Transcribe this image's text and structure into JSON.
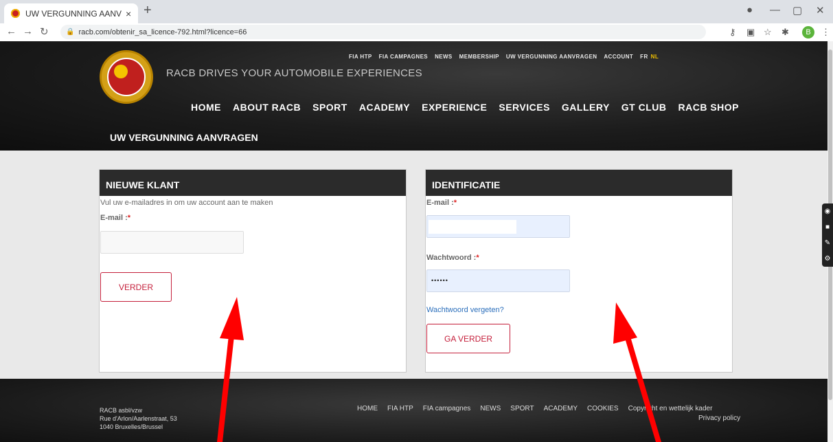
{
  "browser": {
    "tab_title": "UW VERGUNNING AANVRAGEN",
    "tab_close": "×",
    "new_tab": "+",
    "url": "racb.com/obtenir_sa_licence-792.html?licence=66",
    "profile_initial": "B"
  },
  "header": {
    "tagline": "RACB DRIVES YOUR AUTOMOBILE EXPERIENCES",
    "top_menu": [
      "FIA HTP",
      "FIA CAMPAGNES",
      "NEWS",
      "MEMBERSHIP",
      "UW VERGUNNING AANVRAGEN",
      "ACCOUNT"
    ],
    "lang_fr": "FR",
    "lang_nl": "NL",
    "main_menu": [
      "HOME",
      "ABOUT RACB",
      "SPORT",
      "ACADEMY",
      "EXPERIENCE",
      "SERVICES",
      "GALLERY",
      "GT CLUB",
      "RACB SHOP"
    ],
    "page_title": "UW VERGUNNING AANVRAGEN"
  },
  "new_client": {
    "heading": "NIEUWE KLANT",
    "intro": "Vul uw e-mailadres in om uw account aan te maken",
    "email_label": "E-mail :",
    "required": "*",
    "button": "VERDER"
  },
  "identification": {
    "heading": "IDENTIFICATIE",
    "email_label": "E-mail :",
    "password_label": "Wachtwoord :",
    "required": "*",
    "password_value": "••••••",
    "forgot": "Wachtwoord vergeten?",
    "button": "GA VERDER"
  },
  "footer": {
    "address": [
      "RACB asbl/vzw",
      "Rue d'Arlon/Aarlenstraat, 53",
      "1040 Bruxelles/Brussel"
    ],
    "menu": [
      "HOME",
      "FIA HTP",
      "FIA campagnes",
      "NEWS",
      "SPORT",
      "ACADEMY",
      "COOKIES",
      "Copyright en wettelijk kader"
    ],
    "privacy": "Privacy policy"
  },
  "annotations": {
    "arrow_color": "#ff0000"
  }
}
